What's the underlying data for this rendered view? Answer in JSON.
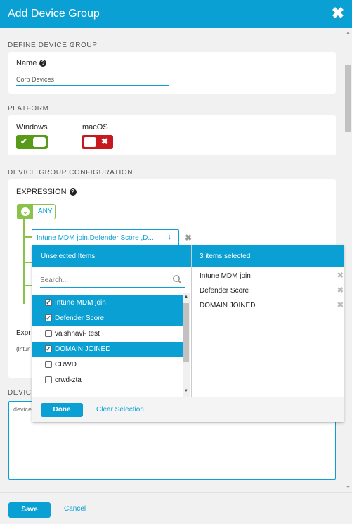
{
  "header": {
    "title": "Add Device Group",
    "close_glyph": "✖"
  },
  "define": {
    "section_title": "DEFINE DEVICE GROUP",
    "name_label": "Name",
    "name_value": "Corp Devices"
  },
  "platform": {
    "section_title": "PLATFORM",
    "windows": {
      "label": "Windows",
      "enabled": true
    },
    "macos": {
      "label": "macOS",
      "enabled": false
    }
  },
  "config": {
    "section_title": "DEVICE GROUP CONFIGURATION",
    "expression_label": "EXPRESSION",
    "operator": "ANY",
    "condition_text": "Intune MDM join,Defender Score ,D...",
    "expression_partial_label": "Expr",
    "expression_partial_value": "(Intun"
  },
  "description": {
    "section_title_partial": "DEVICE",
    "placeholder_partial": "device"
  },
  "dropdown": {
    "unselected_header": "Unselected Items",
    "selected_header": "3 items selected",
    "search_placeholder": "Search...",
    "items": [
      {
        "label": "Intune MDM join",
        "selected": true
      },
      {
        "label": "Defender Score",
        "selected": true
      },
      {
        "label": "vaishnavi- test",
        "selected": false
      },
      {
        "label": "DOMAIN JOINED",
        "selected": true
      },
      {
        "label": "CRWD",
        "selected": false
      },
      {
        "label": "crwd-zta",
        "selected": false
      }
    ],
    "selected_items": [
      "Intune MDM join",
      "Defender Score",
      "DOMAIN JOINED"
    ],
    "done_label": "Done",
    "clear_label": "Clear Selection"
  },
  "footer": {
    "save_label": "Save",
    "cancel_label": "Cancel"
  },
  "colors": {
    "accent": "#0aa0d4",
    "enabled": "#5a9a1a",
    "disabled": "#c8181f",
    "tree": "#8bc34a"
  }
}
